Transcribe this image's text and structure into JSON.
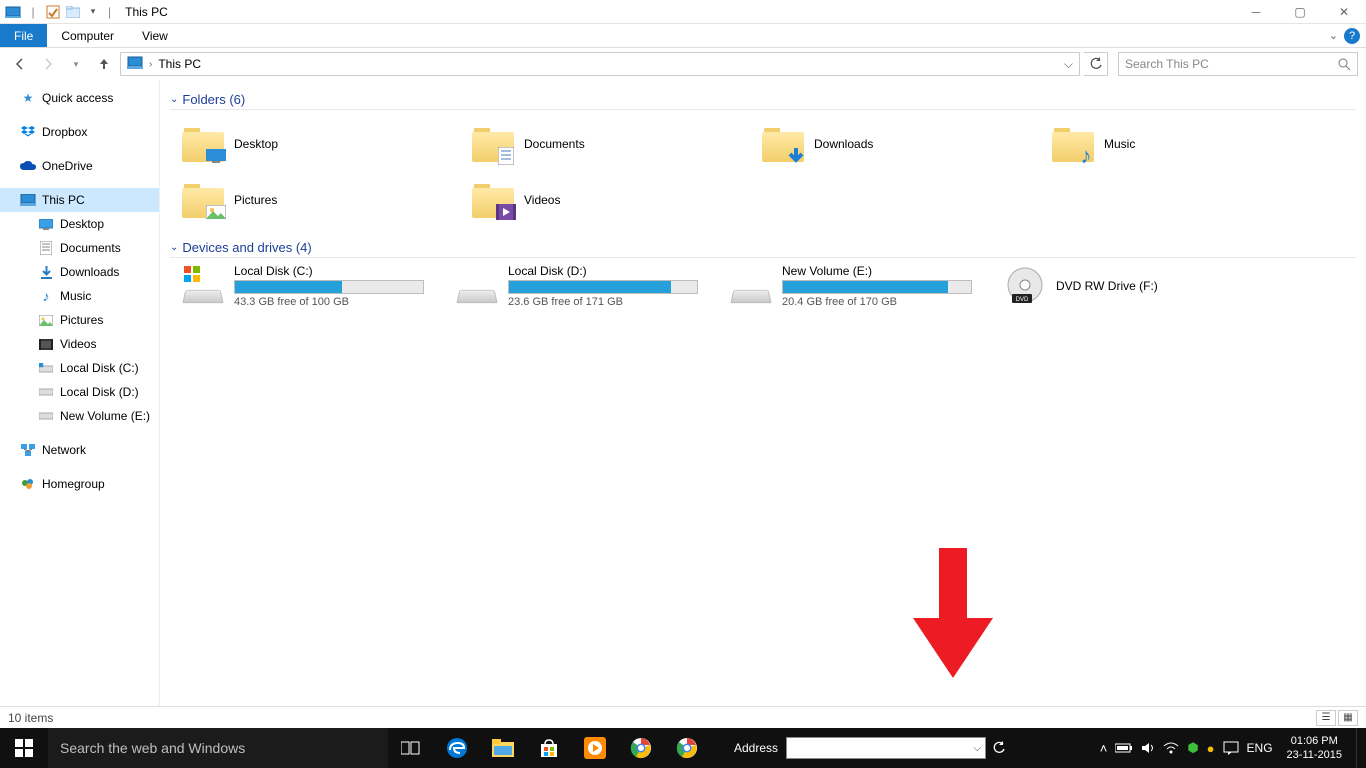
{
  "window": {
    "title": "This PC"
  },
  "ribbon": {
    "tabs": {
      "file": "File",
      "computer": "Computer",
      "view": "View"
    }
  },
  "nav": {
    "breadcrumb": "This PC",
    "search_placeholder": "Search This PC"
  },
  "navpane": {
    "quick_access": "Quick access",
    "dropbox": "Dropbox",
    "onedrive": "OneDrive",
    "this_pc": "This PC",
    "desktop": "Desktop",
    "documents": "Documents",
    "downloads": "Downloads",
    "music": "Music",
    "pictures": "Pictures",
    "videos": "Videos",
    "local_c": "Local Disk (C:)",
    "local_d": "Local Disk (D:)",
    "new_vol_e": "New Volume (E:)",
    "network": "Network",
    "homegroup": "Homegroup"
  },
  "groups": {
    "folders_header": "Folders (6)",
    "drives_header": "Devices and drives (4)"
  },
  "folders": {
    "desktop": "Desktop",
    "documents": "Documents",
    "downloads": "Downloads",
    "music": "Music",
    "pictures": "Pictures",
    "videos": "Videos"
  },
  "drives": {
    "c_name": "Local Disk (C:)",
    "c_free": "43.3 GB free of 100 GB",
    "c_pct": 57,
    "d_name": "Local Disk (D:)",
    "d_free": "23.6 GB free of 171 GB",
    "d_pct": 86,
    "e_name": "New Volume (E:)",
    "e_free": "20.4 GB free of 170 GB",
    "e_pct": 88,
    "f_name": "DVD RW Drive (F:)"
  },
  "statusbar": {
    "items": "10 items"
  },
  "taskbar": {
    "search_placeholder": "Search the web and Windows",
    "address_label": "Address",
    "lang": "ENG",
    "time": "01:06 PM",
    "date": "23-11-2015"
  }
}
